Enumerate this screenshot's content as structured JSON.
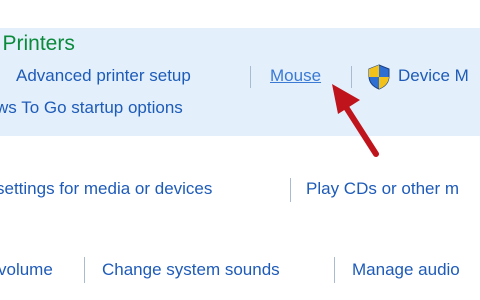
{
  "section": {
    "title": "l Printers",
    "links_row1": {
      "advanced_printer_setup": "Advanced printer setup",
      "mouse": "Mouse",
      "device_manager": "Device M"
    },
    "links_row2": {
      "windows_to_go": "ws To Go startup options"
    }
  },
  "autoplay": {
    "defaults_link": "settings for media or devices",
    "play_cds_link": "Play CDs or other m"
  },
  "sound": {
    "volume_link": "volume",
    "system_sounds_link": "Change system sounds",
    "manage_audio_link": "Manage audio"
  },
  "icons": {
    "shield": "uac-shield-icon",
    "annotation": "red-arrow-icon"
  },
  "colors": {
    "panel_bg": "#e3f0fb",
    "heading": "#0b8a3c",
    "link": "#1e5bb8",
    "arrow": "#c0141c"
  }
}
